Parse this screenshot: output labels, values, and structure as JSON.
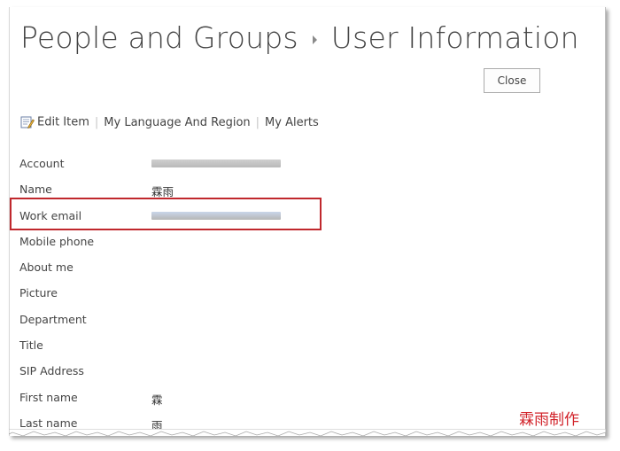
{
  "header": {
    "breadcrumb_parent": "People and Groups",
    "breadcrumb_current": "User Information"
  },
  "actions": {
    "close_label": "Close"
  },
  "toolbar": {
    "edit_item": "Edit Item",
    "my_language_and_region": "My Language And Region",
    "my_alerts": "My Alerts",
    "edit_icon": "edit-item-icon"
  },
  "fields": [
    {
      "label": "Account",
      "value": "",
      "redacted": true
    },
    {
      "label": "Name",
      "value": "霖雨"
    },
    {
      "label": "Work email",
      "value": "",
      "redacted": true
    },
    {
      "label": "Mobile phone",
      "value": ""
    },
    {
      "label": "About me",
      "value": ""
    },
    {
      "label": "Picture",
      "value": ""
    },
    {
      "label": "Department",
      "value": ""
    },
    {
      "label": "Title",
      "value": ""
    },
    {
      "label": "SIP Address",
      "value": ""
    },
    {
      "label": "First name",
      "value": "霖"
    },
    {
      "label": "Last name",
      "value": "雨"
    }
  ],
  "annotation": {
    "highlight_color": "#c0282d",
    "watermark": "霖雨制作",
    "watermark_color": "#d2232a"
  },
  "colors": {
    "text": "#444444",
    "separator": "#c6c6c6"
  }
}
